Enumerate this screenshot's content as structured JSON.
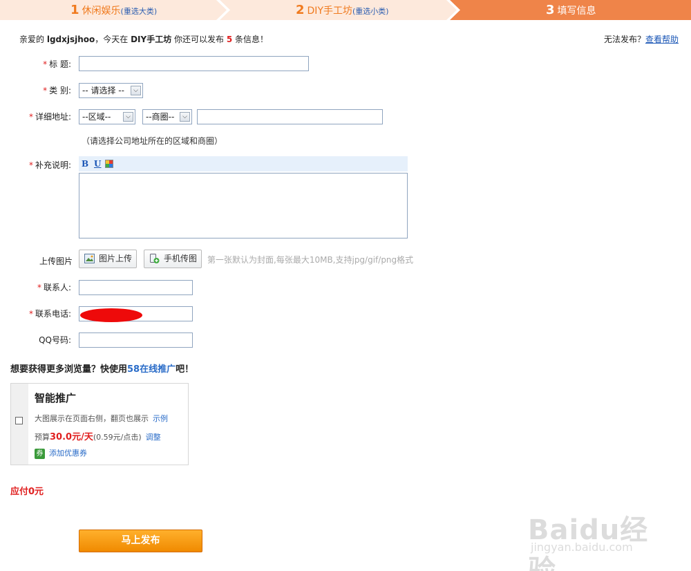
{
  "steps": [
    {
      "num": "1",
      "label": "休闲娱乐",
      "link": "(重选大类)"
    },
    {
      "num": "2",
      "label": "DIY手工坊",
      "link": "(重选小类)"
    },
    {
      "num": "3",
      "label": "填写信息",
      "link": ""
    }
  ],
  "intro": {
    "prefix": "亲爱的 ",
    "username": "lgdxjsjhoo",
    "mid": "，今天在 ",
    "category": "DIY手工坊",
    "mid2": " 你还可以发布 ",
    "count": "5",
    "suffix": " 条信息！"
  },
  "help": {
    "text": "无法发布？",
    "link": "查看帮助"
  },
  "form": {
    "title_label": "标 题:",
    "category_label": "类 别:",
    "category_value": "-- 请选择 --",
    "address_label": "详细地址:",
    "district_value": "--区域--",
    "business_value": "--商圈--",
    "address_note": "（请选择公司地址所在的区域和商圈）",
    "desc_label": "补充说明:",
    "editor": {
      "bold": "B",
      "underline": "U"
    },
    "upload_label": "上传图片",
    "upload_button": "图片上传",
    "mobile_button": "手机传图",
    "upload_hint": "第一张默认为封面,每张最大10MB,支持jpg/gif/png格式",
    "contact_label": "联系人:",
    "phone_label": "联系电话:",
    "qq_label": "QQ号码:",
    "required_mark": "*"
  },
  "promo": {
    "title_pre": "想要获得更多浏览量？快使用",
    "title_hl": "58在线推广",
    "title_post": "吧！",
    "card_title": "智能推广",
    "desc": "大图展示在页面右侧，翻页也展示",
    "example_link": "示例",
    "budget_pre": "预算",
    "budget_value": "30.0元/天",
    "budget_detail": "(0.59元/点击)",
    "adjust_link": "调整",
    "coupon_icon": "券",
    "coupon_link": "添加优惠券"
  },
  "pay_text": "应付0元",
  "submit_label": "马上发布",
  "watermark": {
    "main": "Baidu经验",
    "sub": "jingyan.baidu.com"
  },
  "colors": {
    "accent": "#f07a1e",
    "step_active": "#ef8449",
    "required": "#e02020",
    "link": "#1a56b6"
  }
}
